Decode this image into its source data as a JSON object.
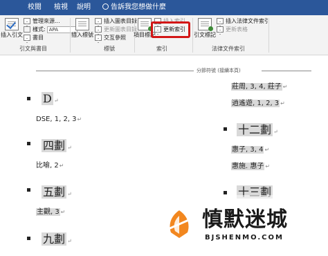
{
  "ribbon_tabs": [
    "校閱",
    "檢視",
    "說明"
  ],
  "tell_me": "告訴我您想做什麼",
  "ribbon": {
    "citations": {
      "insert_citation": "插入引文",
      "manage_sources": "管理來源...",
      "style_label": "樣式:",
      "style_value": "APA",
      "bibliography": "書目",
      "group_label": "引文與書目"
    },
    "captions": {
      "insert_caption": "插入標號",
      "insert_table_of_figures": "插入圖表目錄",
      "update_table": "更新圖表目錄",
      "cross_reference": "交互參照",
      "group_label": "標號"
    },
    "index": {
      "mark_entry": "項目標記",
      "insert_index": "插入索引",
      "update_index": "更新索引",
      "group_label": "索引"
    },
    "authorities": {
      "mark_citation": "引文標記",
      "insert_table": "插入法律文件索引",
      "update_table": "更新表格",
      "group_label": "法律文件索引"
    }
  },
  "section_break": "分節符號 (接續本頁)",
  "index_left": [
    {
      "heading": "D",
      "entries": [
        {
          "text": "DSE, 1, 2, 3",
          "highlight": false
        }
      ]
    },
    {
      "heading": "四劃",
      "entries": [
        {
          "text": "比喻, 2",
          "highlight": false
        }
      ]
    },
    {
      "heading": "五劃",
      "entries": [
        {
          "text": "主觀, 3",
          "highlight": true
        }
      ]
    },
    {
      "heading": "九劃",
      "entries": []
    }
  ],
  "index_right": {
    "top_entries": [
      {
        "text": "莊周, 3, 4,  莊子",
        "highlight": true
      },
      {
        "text": "逍遙遊, 1, 2, 3",
        "highlight": true
      }
    ],
    "sections": [
      {
        "heading": "十二劃",
        "entries": [
          {
            "text": "惠子, 3, 4",
            "highlight": true
          },
          {
            "text": "惠施.  惠子",
            "highlight": true
          }
        ]
      },
      {
        "heading": "十三劃",
        "entries": []
      }
    ]
  },
  "watermark": {
    "title": "慎默迷城",
    "subtitle": "BJSHENMO.COM"
  },
  "colors": {
    "ribbon_tab_bg": "#2b579a",
    "ribbon_bg": "#f3f3f3",
    "highlight_red": "#d31616",
    "field_shading": "#d9d9d9"
  }
}
